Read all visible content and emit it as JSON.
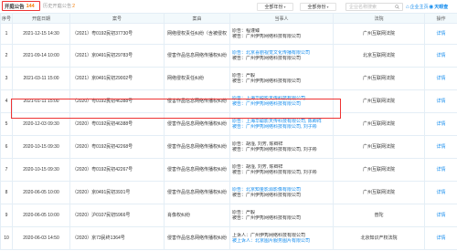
{
  "tabs": {
    "active_label": "开庭公告",
    "active_count": "144",
    "history_label": "历史开庭公告",
    "history_count": "2"
  },
  "toolbar": {
    "year_filter": "全部年份",
    "role_filter": "全部身份",
    "search_placeholder": "企业名称搜索",
    "favorite_label": "企业主页",
    "logo_label": "天眼查"
  },
  "table": {
    "columns": [
      "序号",
      "开庭日期",
      "案号",
      "案由",
      "当事人",
      "法院",
      "操作"
    ],
    "rows": [
      {
        "no": "1",
        "date": "2021-12-15 14:30",
        "case": "（2021）粤0192民初37730号",
        "cause": "网络侵权责任纠纷（含被侵权",
        "p1": "原告：程谨臻",
        "p2": "被告：广州伊秀网络科技有限公司",
        "court": "广州互联网法院",
        "action": "详情"
      },
      {
        "no": "2",
        "date": "2021-09-14 10:00",
        "case": "（2021）京0491民初29783号",
        "cause": "侵害作品信息网络传播权纠纷",
        "p1": "原告：北京喜剧视觉文化传播有限公司",
        "p2": "被告：广州伊秀网络科技有限公司",
        "court": "北京互联网法院",
        "action": "详情"
      },
      {
        "no": "3",
        "date": "2021-03-11 15:00",
        "case": "（2021）京0491民初29002号",
        "cause": "网络侵权责任纠纷",
        "p1": "原告：严毅",
        "p2": "被告：广州伊秀网络科技有限公司",
        "court": "广州互联网法院",
        "action": "详情"
      },
      {
        "no": "4",
        "date": "2021-01-11 15:00",
        "case": "（2020）粤0192民初46388号",
        "cause": "侵害作品信息网络传播权纠纷",
        "p1": "原告：上海华聪影天传科技有限公司",
        "p2": "被告：广州伊秀网络科技有限公司",
        "court": "广州互联网法院",
        "action": "详情"
      },
      {
        "no": "5",
        "date": "2020-12-03 09:30",
        "case": "（2020）粤0192民初46388号",
        "cause": "侵害作品信息网络传播权纠纷",
        "p1": "原告：上海华聪影天传科技有限公司, 陈卿祥",
        "p2": "被告：广州伊秀网络科技有限公司, 刘子彬",
        "court": "广州互联网法院",
        "action": "详情"
      },
      {
        "no": "6",
        "date": "2020-10-15 09:30",
        "case": "（2020）粤0192民初42268号",
        "cause": "侵害作品信息网络传播权纠纷",
        "p1": "原告：胡淦, 刘芳, 陈卿祥",
        "p2": "被告：广州伊秀网络科技有限公司, 刘子彬",
        "court": "广州互联网法院",
        "action": "详情"
      },
      {
        "no": "7",
        "date": "2020-10-15 09:30",
        "case": "（2020）粤0192民初42267号",
        "cause": "侵害作品信息网络传播权纠纷",
        "p1": "原告：胡淦, 刘芳, 陈卿祥",
        "p2": "被告：广州伊秀网络科技有限公司, 刘子彬",
        "court": "广州互联网法院",
        "action": "详情"
      },
      {
        "no": "8",
        "date": "2020-06-05 10:00",
        "case": "（2020）京0491民初3931号",
        "cause": "侵害作品信息网络传播权纠纷",
        "p1": "原告：北京知金影源影像有限公司",
        "p2": "被告：广州伊秀网络科技有限公司",
        "court": "广州互联网法院",
        "action": "详情"
      },
      {
        "no": "9",
        "date": "2020-06-05 10:00",
        "case": "（2020）沪0107民初5966号",
        "cause": "肖像权纠纷",
        "p1": "原告：严毅",
        "p2": "被告：广州伊秀网络科技有限公司",
        "court": "普陀",
        "action": "详情"
      },
      {
        "no": "10",
        "date": "2020-06-03 14:50",
        "case": "（2020）京73民终1364号",
        "cause": "侵害作品信息网络传播权纠纷",
        "p1": "上诉人：广州伊秀网络科技有限公司",
        "p2": "被上诉人：北京图片服务图片有限公司",
        "court": "北京知识产权法院",
        "action": "详情"
      }
    ]
  },
  "colors": {
    "accent": "#128bed",
    "highlight": "#ee3333",
    "count": "#f57a00",
    "header_bg": "#f2f9fc"
  }
}
